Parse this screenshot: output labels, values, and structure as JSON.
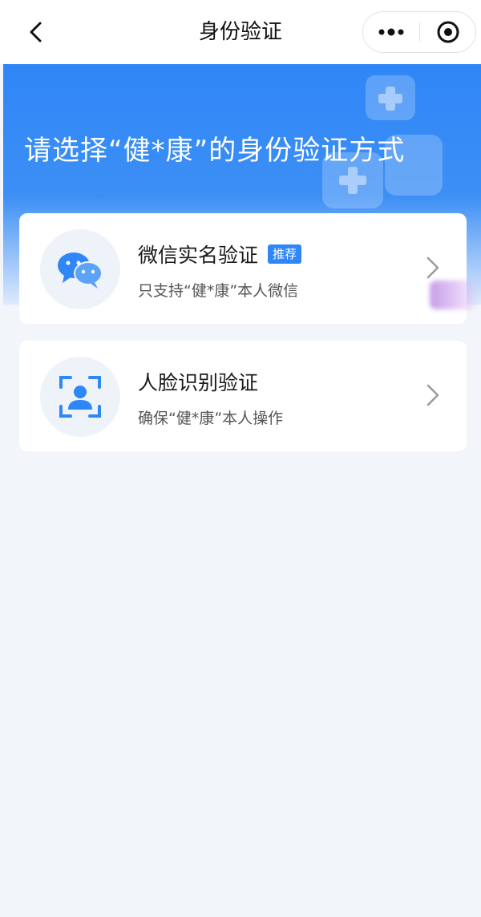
{
  "navbar": {
    "title": "身份验证",
    "back_icon": "chevron-left-icon",
    "more_icon": "more-dots-icon",
    "close_icon": "target-circle-icon"
  },
  "hero": {
    "title": "请选择“健*康”的身份验证方式",
    "background_color": "#2f86f6"
  },
  "options": [
    {
      "title": "微信实名验证",
      "badge": "推荐",
      "subtitle": "只支持“健*康”本人微信",
      "icon": "wechat-icon"
    },
    {
      "title": "人脸识别验证",
      "subtitle": "确保“健*康”本人操作",
      "icon": "face-scan-icon"
    }
  ],
  "colors": {
    "accent": "#2f86f6",
    "page_background": "#f2f5f9",
    "card_background": "#ffffff"
  }
}
